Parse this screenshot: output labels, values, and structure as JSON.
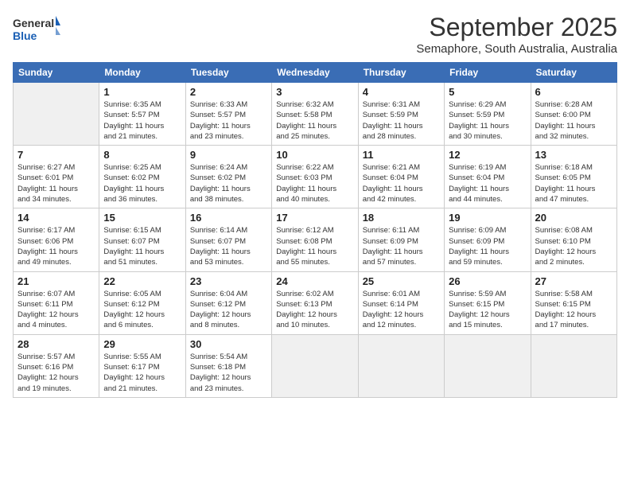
{
  "logo": {
    "line1": "General",
    "line2": "Blue"
  },
  "title": "September 2025",
  "location": "Semaphore, South Australia, Australia",
  "weekdays": [
    "Sunday",
    "Monday",
    "Tuesday",
    "Wednesday",
    "Thursday",
    "Friday",
    "Saturday"
  ],
  "weeks": [
    [
      {
        "day": "",
        "info": ""
      },
      {
        "day": "1",
        "info": "Sunrise: 6:35 AM\nSunset: 5:57 PM\nDaylight: 11 hours\nand 21 minutes."
      },
      {
        "day": "2",
        "info": "Sunrise: 6:33 AM\nSunset: 5:57 PM\nDaylight: 11 hours\nand 23 minutes."
      },
      {
        "day": "3",
        "info": "Sunrise: 6:32 AM\nSunset: 5:58 PM\nDaylight: 11 hours\nand 25 minutes."
      },
      {
        "day": "4",
        "info": "Sunrise: 6:31 AM\nSunset: 5:59 PM\nDaylight: 11 hours\nand 28 minutes."
      },
      {
        "day": "5",
        "info": "Sunrise: 6:29 AM\nSunset: 5:59 PM\nDaylight: 11 hours\nand 30 minutes."
      },
      {
        "day": "6",
        "info": "Sunrise: 6:28 AM\nSunset: 6:00 PM\nDaylight: 11 hours\nand 32 minutes."
      }
    ],
    [
      {
        "day": "7",
        "info": "Sunrise: 6:27 AM\nSunset: 6:01 PM\nDaylight: 11 hours\nand 34 minutes."
      },
      {
        "day": "8",
        "info": "Sunrise: 6:25 AM\nSunset: 6:02 PM\nDaylight: 11 hours\nand 36 minutes."
      },
      {
        "day": "9",
        "info": "Sunrise: 6:24 AM\nSunset: 6:02 PM\nDaylight: 11 hours\nand 38 minutes."
      },
      {
        "day": "10",
        "info": "Sunrise: 6:22 AM\nSunset: 6:03 PM\nDaylight: 11 hours\nand 40 minutes."
      },
      {
        "day": "11",
        "info": "Sunrise: 6:21 AM\nSunset: 6:04 PM\nDaylight: 11 hours\nand 42 minutes."
      },
      {
        "day": "12",
        "info": "Sunrise: 6:19 AM\nSunset: 6:04 PM\nDaylight: 11 hours\nand 44 minutes."
      },
      {
        "day": "13",
        "info": "Sunrise: 6:18 AM\nSunset: 6:05 PM\nDaylight: 11 hours\nand 47 minutes."
      }
    ],
    [
      {
        "day": "14",
        "info": "Sunrise: 6:17 AM\nSunset: 6:06 PM\nDaylight: 11 hours\nand 49 minutes."
      },
      {
        "day": "15",
        "info": "Sunrise: 6:15 AM\nSunset: 6:07 PM\nDaylight: 11 hours\nand 51 minutes."
      },
      {
        "day": "16",
        "info": "Sunrise: 6:14 AM\nSunset: 6:07 PM\nDaylight: 11 hours\nand 53 minutes."
      },
      {
        "day": "17",
        "info": "Sunrise: 6:12 AM\nSunset: 6:08 PM\nDaylight: 11 hours\nand 55 minutes."
      },
      {
        "day": "18",
        "info": "Sunrise: 6:11 AM\nSunset: 6:09 PM\nDaylight: 11 hours\nand 57 minutes."
      },
      {
        "day": "19",
        "info": "Sunrise: 6:09 AM\nSunset: 6:09 PM\nDaylight: 11 hours\nand 59 minutes."
      },
      {
        "day": "20",
        "info": "Sunrise: 6:08 AM\nSunset: 6:10 PM\nDaylight: 12 hours\nand 2 minutes."
      }
    ],
    [
      {
        "day": "21",
        "info": "Sunrise: 6:07 AM\nSunset: 6:11 PM\nDaylight: 12 hours\nand 4 minutes."
      },
      {
        "day": "22",
        "info": "Sunrise: 6:05 AM\nSunset: 6:12 PM\nDaylight: 12 hours\nand 6 minutes."
      },
      {
        "day": "23",
        "info": "Sunrise: 6:04 AM\nSunset: 6:12 PM\nDaylight: 12 hours\nand 8 minutes."
      },
      {
        "day": "24",
        "info": "Sunrise: 6:02 AM\nSunset: 6:13 PM\nDaylight: 12 hours\nand 10 minutes."
      },
      {
        "day": "25",
        "info": "Sunrise: 6:01 AM\nSunset: 6:14 PM\nDaylight: 12 hours\nand 12 minutes."
      },
      {
        "day": "26",
        "info": "Sunrise: 5:59 AM\nSunset: 6:15 PM\nDaylight: 12 hours\nand 15 minutes."
      },
      {
        "day": "27",
        "info": "Sunrise: 5:58 AM\nSunset: 6:15 PM\nDaylight: 12 hours\nand 17 minutes."
      }
    ],
    [
      {
        "day": "28",
        "info": "Sunrise: 5:57 AM\nSunset: 6:16 PM\nDaylight: 12 hours\nand 19 minutes."
      },
      {
        "day": "29",
        "info": "Sunrise: 5:55 AM\nSunset: 6:17 PM\nDaylight: 12 hours\nand 21 minutes."
      },
      {
        "day": "30",
        "info": "Sunrise: 5:54 AM\nSunset: 6:18 PM\nDaylight: 12 hours\nand 23 minutes."
      },
      {
        "day": "",
        "info": ""
      },
      {
        "day": "",
        "info": ""
      },
      {
        "day": "",
        "info": ""
      },
      {
        "day": "",
        "info": ""
      }
    ]
  ]
}
